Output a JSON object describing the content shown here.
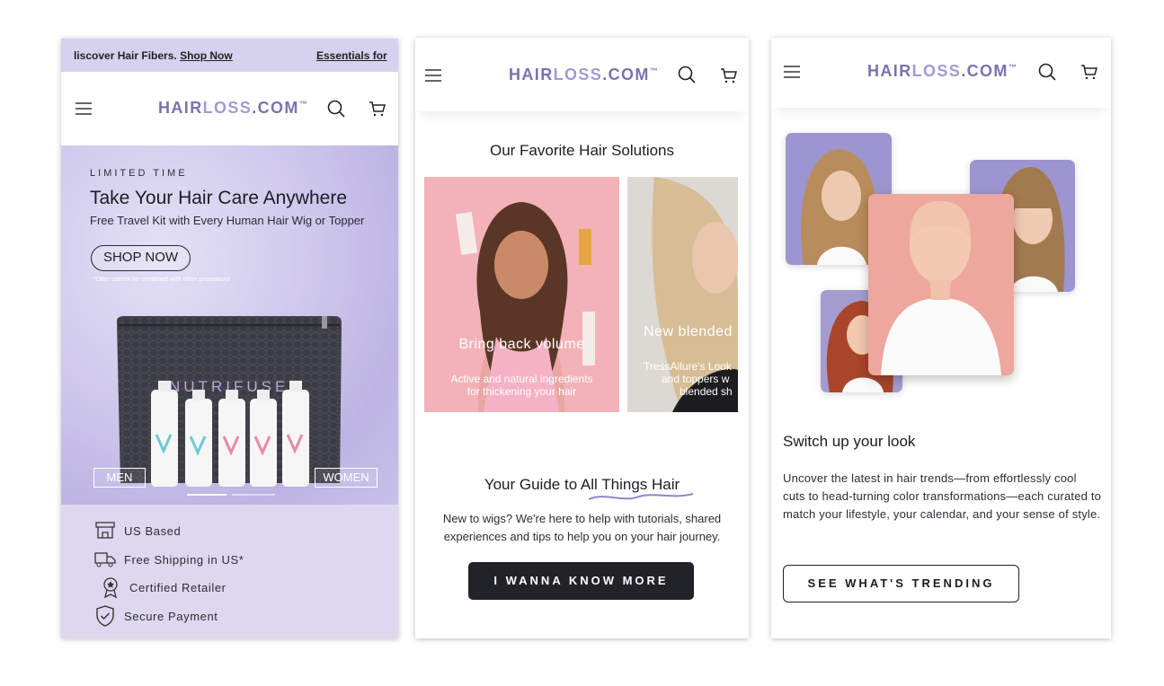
{
  "brand": {
    "logo_main": "HAIR",
    "logo_light": "LOSS",
    "logo_tail": ".COM",
    "logo_mark": "™",
    "accent": "#7b72b0",
    "accent_light": "#a39ad0"
  },
  "panel1": {
    "ticker": {
      "text_prefix": "liscover Hair Fibers. ",
      "link": "Shop Now",
      "text_right": "Essentials for"
    },
    "hero": {
      "kicker": "LIMITED TIME",
      "title": "Take Your Hair Care Anywhere",
      "subtitle": "Free Travel Kit with Every Human Hair Wig or Topper",
      "button": "SHOP NOW",
      "fine_print": "*Offer cannot be combined with other promotions",
      "bag_brand": "NUTRIFUSE",
      "left_button": "MEN",
      "right_button": "WOMEN"
    },
    "features": [
      {
        "icon": "storefront-icon",
        "label": "US Based"
      },
      {
        "icon": "truck-icon",
        "label": "Free Shipping in US*"
      },
      {
        "icon": "badge-icon",
        "label": "Certified Retailer"
      },
      {
        "icon": "shield-check-icon",
        "label": "Secure Payment"
      }
    ]
  },
  "panel2": {
    "section_title": "Our Favorite Hair Solutions",
    "cards": [
      {
        "title": "Bring back volume",
        "subtitle_line1": "Active and natural ingredients",
        "subtitle_line2": "for thickening your hair"
      },
      {
        "title": "New blended",
        "subtitle_line1": "TressAllure's Look",
        "subtitle_line2": "and toppers w",
        "subtitle_line3": "blended sh"
      }
    ],
    "guide_title_prefix": "Your Guide to All ",
    "guide_title_accent": "Things Hair",
    "guide_text_line1": "New to wigs? We're here to help with tutorials, shared",
    "guide_text_line2": "experiences and tips to help you on your hair journey.",
    "button": "I WANNA KNOW MORE"
  },
  "panel3": {
    "title": "Switch up your look",
    "paragraph": "Uncover the latest in hair trends—from effortlessly cool cuts to head-turning color transformations—each curated to match your lifestyle, your calendar, and your sense of style.",
    "button": "SEE WHAT'S TRENDING"
  }
}
